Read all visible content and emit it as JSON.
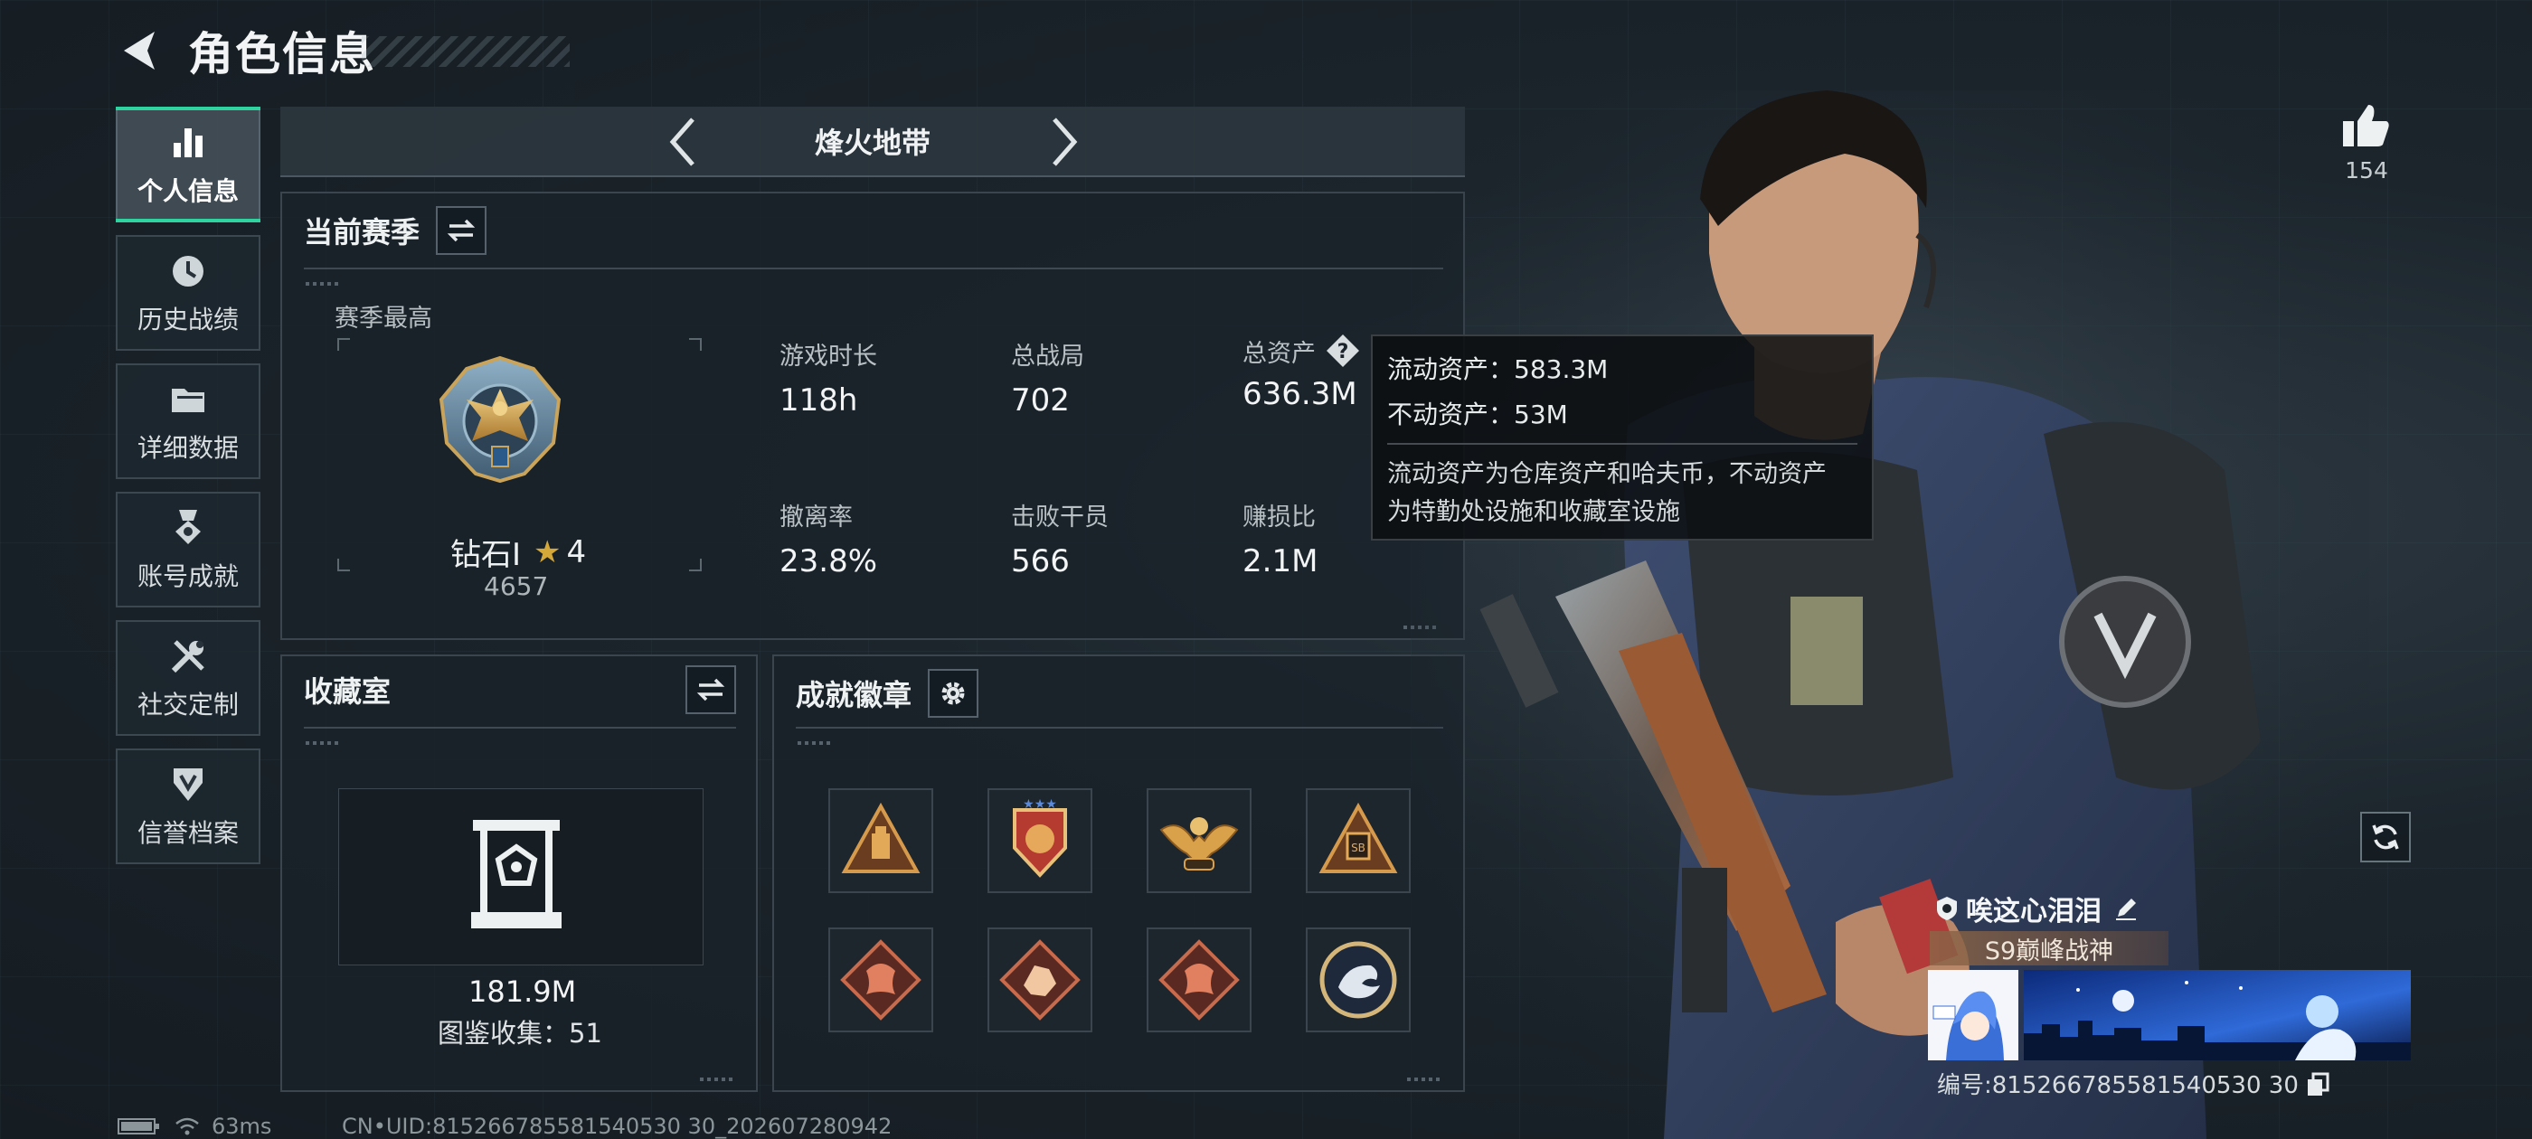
{
  "header": {
    "title": "角色信息"
  },
  "sidebar": {
    "items": [
      {
        "label": "个人信息",
        "icon": "bar-chart-icon",
        "active": true
      },
      {
        "label": "历史战绩",
        "icon": "clock-icon"
      },
      {
        "label": "详细数据",
        "icon": "folder-icon"
      },
      {
        "label": "账号成就",
        "icon": "medal-icon"
      },
      {
        "label": "社交定制",
        "icon": "tools-icon"
      },
      {
        "label": "信誉档案",
        "icon": "shield-icon"
      }
    ]
  },
  "mode": {
    "title": "烽火地带"
  },
  "season": {
    "title": "当前赛季",
    "best_label": "赛季最高",
    "rank_name": "钻石Ⅰ",
    "rank_stars": "4",
    "rank_points": "4657",
    "stats": [
      {
        "label": "游戏时长",
        "value": "118h"
      },
      {
        "label": "总战局",
        "value": "702"
      },
      {
        "label": "总资产",
        "value": "636.3M"
      },
      {
        "label": "撤离率",
        "value": "23.8%"
      },
      {
        "label": "击败干员",
        "value": "566"
      },
      {
        "label": "赚损比",
        "value": "2.1M"
      }
    ]
  },
  "tooltip": {
    "liquid": "流动资产：583.3M",
    "fixed": "不动资产：53M",
    "desc_1": "流动资产为仓库资产和哈夫币，不动资产",
    "desc_2": "为特勤处设施和收藏室设施"
  },
  "collection": {
    "title": "收藏室",
    "value": "181.9M",
    "count_label": "图鉴收集：51"
  },
  "badges": {
    "title": "成就徽章",
    "items": [
      {
        "icon": "triangle-crate-badge-icon",
        "accent": "#c98a3c"
      },
      {
        "icon": "shield-star-badge-icon",
        "accent": "#c64a3c"
      },
      {
        "icon": "eagle-crest-badge-icon",
        "accent": "#d4a24c"
      },
      {
        "icon": "triangle-sb-badge-icon",
        "accent": "#c98a3c"
      },
      {
        "icon": "dragon-diamond-badge-icon",
        "accent": "#b8503c"
      },
      {
        "icon": "fist-diamond-badge-icon",
        "accent": "#c0603c"
      },
      {
        "icon": "dragon-diamond-badge-icon",
        "accent": "#b8503c"
      },
      {
        "icon": "dragon-round-badge-icon",
        "accent": "#c9b27a"
      }
    ]
  },
  "profile": {
    "likes": "154",
    "name": "唉这心泪泪",
    "title_tag": "S9巅峰战神",
    "id_label": "编号:815266785581540530 30"
  },
  "status": {
    "ping": "63ms",
    "uid": "CN•UID:815266785581540530 30_202607280942"
  },
  "colors": {
    "accent": "#2ed3a0",
    "panel_border": "#3a454d",
    "background": "#1c252c"
  }
}
